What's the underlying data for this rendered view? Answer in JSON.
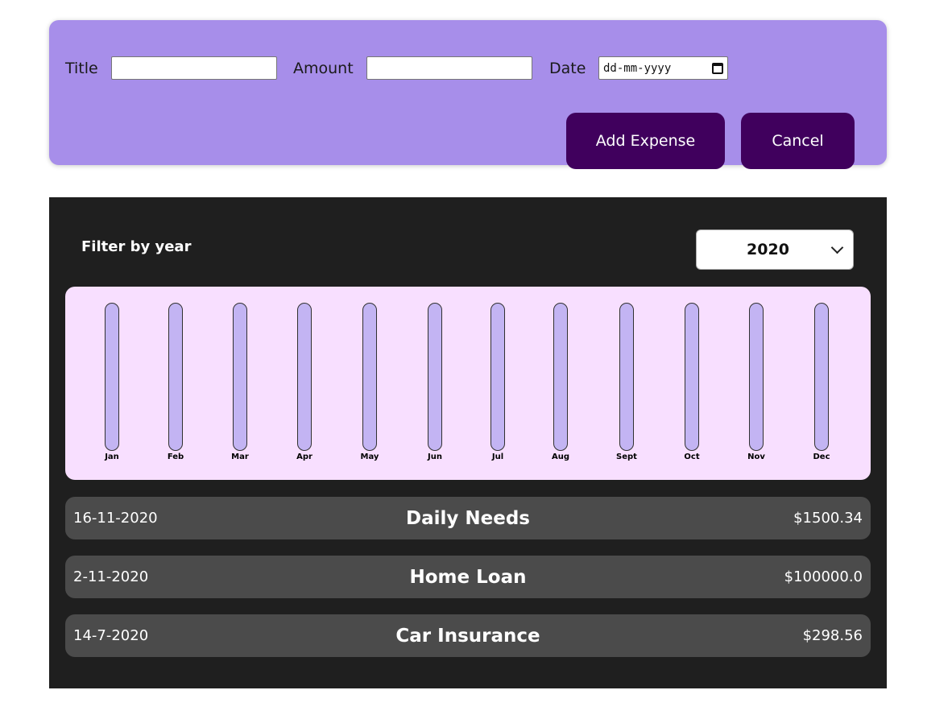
{
  "form": {
    "title_label": "Title",
    "title_value": "",
    "amount_label": "Amount",
    "amount_value": "",
    "date_label": "Date",
    "date_placeholder": "dd-mm-yyyy",
    "add_button": "Add Expense",
    "cancel_button": "Cancel"
  },
  "filter": {
    "label": "Filter by year",
    "selected_year": "2020"
  },
  "chart_data": {
    "type": "bar",
    "categories": [
      "Jan",
      "Feb",
      "Mar",
      "Apr",
      "May",
      "Jun",
      "Jul",
      "Aug",
      "Sept",
      "Oct",
      "Nov",
      "Dec"
    ],
    "values": [
      0,
      0,
      0,
      0,
      0,
      0,
      0,
      0,
      0,
      0,
      0,
      0
    ],
    "xlabel": "",
    "ylabel": ""
  },
  "expenses": [
    {
      "date": "16-11-2020",
      "title": "Daily Needs",
      "amount": "$1500.34"
    },
    {
      "date": "2-11-2020",
      "title": "Home Loan",
      "amount": "$100000.0"
    },
    {
      "date": "14-7-2020",
      "title": "Car Insurance",
      "amount": "$298.56"
    }
  ],
  "colors": {
    "form_bg": "#a78eea",
    "button_bg": "#40005d",
    "panel_bg": "#1f1f1f",
    "chart_bg": "#f8dfff",
    "bar_bg": "#c3b4f3",
    "item_bg": "#4b4b4b"
  }
}
